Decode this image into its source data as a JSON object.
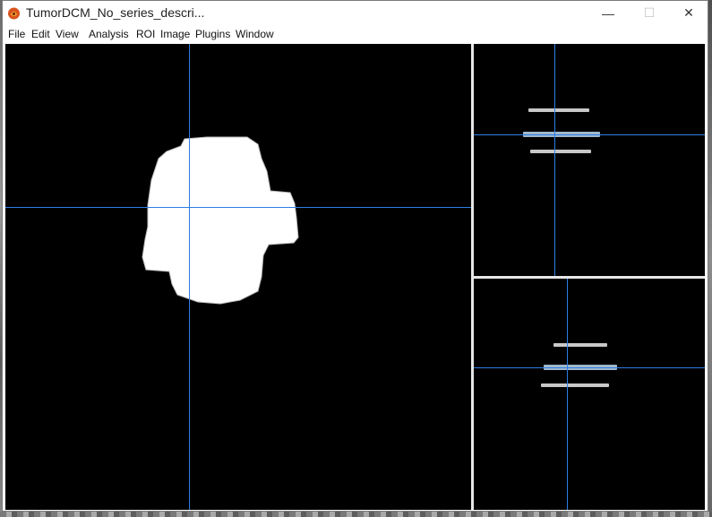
{
  "window": {
    "title": "TumorDCM_No_series_descri...",
    "minimize_glyph": "—",
    "maximize_glyph": "☐",
    "close_glyph": "✕",
    "app_icon": "ij-app-icon"
  },
  "menubar": {
    "items": [
      "File",
      "Edit",
      "View",
      "Analysis",
      "ROI",
      "Image",
      "Plugins",
      "Window"
    ]
  },
  "colors": {
    "crosshair": "#2f7de6",
    "mask": "#ffffff",
    "background": "#000000",
    "slice_bar": "#c8c8c8"
  },
  "views": {
    "main": "axial-view",
    "top_right": "coronal-view",
    "bottom_right": "sagittal-view"
  }
}
